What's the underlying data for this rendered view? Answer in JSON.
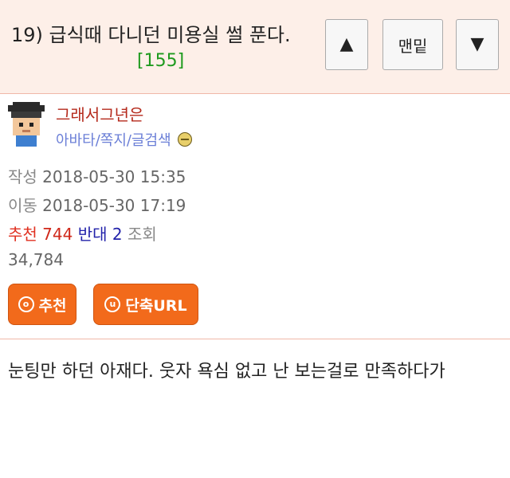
{
  "header": {
    "title": "19) 급식때 다니던 미용실 썰 푼다.",
    "comment_count": "[155]",
    "up_icon": "triangle-up-icon",
    "bottom_label": "맨밑",
    "down_icon": "triangle-down-icon"
  },
  "author": {
    "nickname": "그래서그년은",
    "links": [
      "아바타",
      "쪽지",
      "글검색"
    ],
    "link_separator": "/",
    "avatar_icon": "pixel-avatar-icon"
  },
  "meta": {
    "written_label": "작성",
    "written": "2018-05-30 15:35",
    "moved_label": "이동",
    "moved": "2018-05-30 17:19",
    "recommend_label": "추천",
    "recommend": "744",
    "oppose_label": "반대",
    "oppose": "2",
    "views_label": "조회",
    "views": "34,784"
  },
  "actions": {
    "recommend_button": "추천",
    "recommend_badge": "ⓞ",
    "short_url_button": "단축URL",
    "short_url_badge": "u"
  },
  "content": {
    "text": "눈팅만 하던 아재다. 웃자 욕심 없고 난 보는걸로 만족하다가"
  },
  "colors": {
    "header_bg": "#fdefe8",
    "accent_orange": "#f26a1b",
    "count_green": "#1e9a1e",
    "nickname_red": "#b52a1c",
    "link_blue": "#6b7fd7"
  }
}
